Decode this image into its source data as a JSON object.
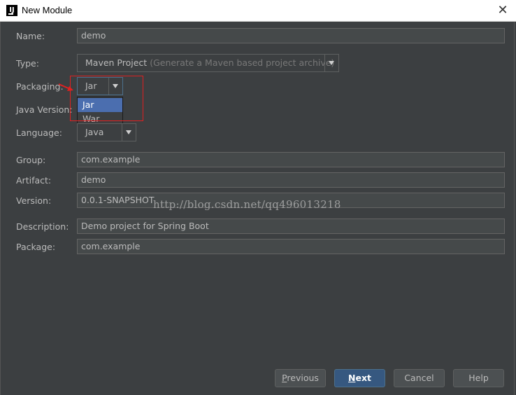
{
  "window": {
    "title": "New Module",
    "close_glyph": "✕",
    "app_icon_label": "IJ"
  },
  "form": {
    "name": {
      "label": "Name:",
      "value": "demo"
    },
    "type": {
      "label": "Type:",
      "value": "Maven Project",
      "hint": "(Generate a Maven based project archive)"
    },
    "packaging": {
      "label": "Packaging:",
      "value": "Jar",
      "options": [
        "Jar",
        "War"
      ],
      "highlighted": "Jar"
    },
    "java_version": {
      "label": "Java Version:"
    },
    "language": {
      "label": "Language:",
      "value": "Java"
    },
    "group": {
      "label": "Group:",
      "value": "com.example"
    },
    "artifact": {
      "label": "Artifact:",
      "value": "demo"
    },
    "version": {
      "label": "Version:",
      "value": "0.0.1-SNAPSHOT"
    },
    "description": {
      "label": "Description:",
      "value": "Demo project for Spring Boot"
    },
    "package": {
      "label": "Package:",
      "value": "com.example"
    }
  },
  "watermark": "http://blog.csdn.net/qq496013218",
  "buttons": {
    "previous": {
      "first": "P",
      "rest": "revious"
    },
    "next": {
      "first": "N",
      "rest": "ext"
    },
    "cancel": "Cancel",
    "help": "Help"
  },
  "colors": {
    "background": "#3c3f41",
    "field_bg": "#45494a",
    "selection": "#4b6eaf",
    "primary_button": "#365880",
    "annotation": "#e02020"
  }
}
